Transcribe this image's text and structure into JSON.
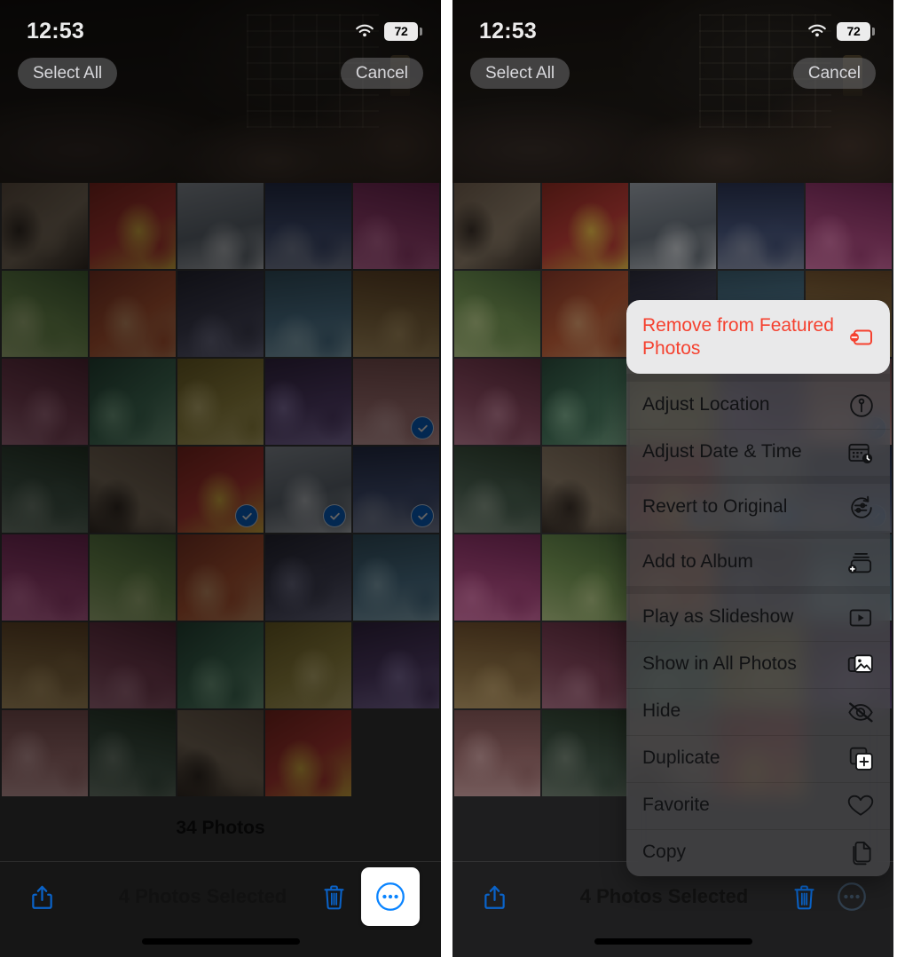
{
  "status_bar": {
    "time": "12:53",
    "wifi_icon": "wifi-icon",
    "battery_level": "72"
  },
  "nav": {
    "select_all_label": "Select All",
    "cancel_label": "Cancel"
  },
  "grid": {
    "photo_count_label": "34 Photos",
    "columns": 5,
    "total_cells": 34,
    "selected_indices": [
      14,
      17,
      18,
      19
    ]
  },
  "toolbar": {
    "share_icon": "share-icon",
    "selection_label": "4 Photos Selected",
    "delete_icon": "trash-icon",
    "more_icon": "more-circle-icon"
  },
  "context_menu": {
    "items": [
      {
        "label": "Remove from Featured Photos",
        "icon": "remove-from-featured-icon",
        "destructive": true
      },
      {
        "label": "Adjust Location",
        "icon": "location-pin-circle-icon",
        "destructive": false
      },
      {
        "label": "Adjust Date & Time",
        "icon": "calendar-clock-icon",
        "destructive": false
      },
      {
        "label": "Revert to Original",
        "icon": "revert-icon",
        "destructive": false
      },
      {
        "label": "Add to Album",
        "icon": "add-to-album-icon",
        "destructive": false
      },
      {
        "label": "Play as Slideshow",
        "icon": "play-slideshow-icon",
        "destructive": false
      },
      {
        "label": "Show in All Photos",
        "icon": "all-photos-icon",
        "destructive": false
      },
      {
        "label": "Hide",
        "icon": "hide-eye-icon",
        "destructive": false
      },
      {
        "label": "Duplicate",
        "icon": "duplicate-icon",
        "destructive": false
      },
      {
        "label": "Favorite",
        "icon": "heart-icon",
        "destructive": false
      },
      {
        "label": "Copy",
        "icon": "copy-icon",
        "destructive": false
      }
    ]
  },
  "colors": {
    "accent_blue": "#0a69d6",
    "destructive_red": "#f5412f",
    "menu_background": "#464648",
    "highlight_background": "#e9e9ea"
  }
}
